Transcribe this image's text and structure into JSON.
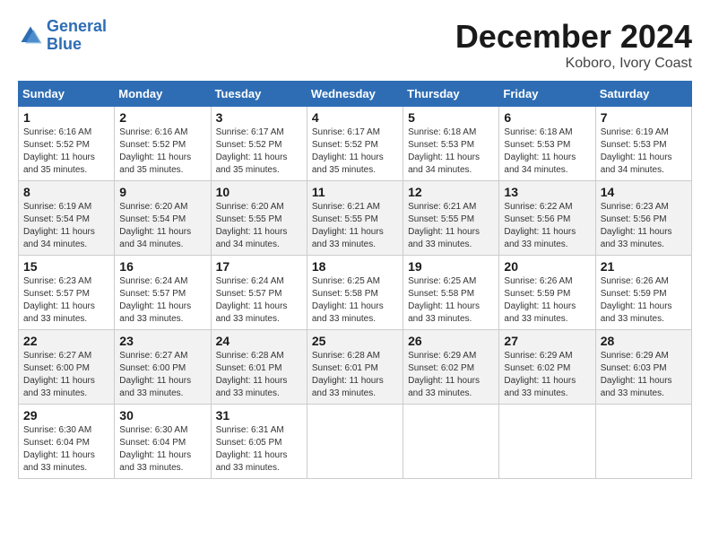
{
  "logo": {
    "line1": "General",
    "line2": "Blue"
  },
  "title": "December 2024",
  "subtitle": "Koboro, Ivory Coast",
  "days_header": [
    "Sunday",
    "Monday",
    "Tuesday",
    "Wednesday",
    "Thursday",
    "Friday",
    "Saturday"
  ],
  "weeks": [
    [
      {
        "day": "1",
        "sunrise": "6:16 AM",
        "sunset": "5:52 PM",
        "daylight": "11 hours and 35 minutes."
      },
      {
        "day": "2",
        "sunrise": "6:16 AM",
        "sunset": "5:52 PM",
        "daylight": "11 hours and 35 minutes."
      },
      {
        "day": "3",
        "sunrise": "6:17 AM",
        "sunset": "5:52 PM",
        "daylight": "11 hours and 35 minutes."
      },
      {
        "day": "4",
        "sunrise": "6:17 AM",
        "sunset": "5:52 PM",
        "daylight": "11 hours and 35 minutes."
      },
      {
        "day": "5",
        "sunrise": "6:18 AM",
        "sunset": "5:53 PM",
        "daylight": "11 hours and 34 minutes."
      },
      {
        "day": "6",
        "sunrise": "6:18 AM",
        "sunset": "5:53 PM",
        "daylight": "11 hours and 34 minutes."
      },
      {
        "day": "7",
        "sunrise": "6:19 AM",
        "sunset": "5:53 PM",
        "daylight": "11 hours and 34 minutes."
      }
    ],
    [
      {
        "day": "8",
        "sunrise": "6:19 AM",
        "sunset": "5:54 PM",
        "daylight": "11 hours and 34 minutes."
      },
      {
        "day": "9",
        "sunrise": "6:20 AM",
        "sunset": "5:54 PM",
        "daylight": "11 hours and 34 minutes."
      },
      {
        "day": "10",
        "sunrise": "6:20 AM",
        "sunset": "5:55 PM",
        "daylight": "11 hours and 34 minutes."
      },
      {
        "day": "11",
        "sunrise": "6:21 AM",
        "sunset": "5:55 PM",
        "daylight": "11 hours and 33 minutes."
      },
      {
        "day": "12",
        "sunrise": "6:21 AM",
        "sunset": "5:55 PM",
        "daylight": "11 hours and 33 minutes."
      },
      {
        "day": "13",
        "sunrise": "6:22 AM",
        "sunset": "5:56 PM",
        "daylight": "11 hours and 33 minutes."
      },
      {
        "day": "14",
        "sunrise": "6:23 AM",
        "sunset": "5:56 PM",
        "daylight": "11 hours and 33 minutes."
      }
    ],
    [
      {
        "day": "15",
        "sunrise": "6:23 AM",
        "sunset": "5:57 PM",
        "daylight": "11 hours and 33 minutes."
      },
      {
        "day": "16",
        "sunrise": "6:24 AM",
        "sunset": "5:57 PM",
        "daylight": "11 hours and 33 minutes."
      },
      {
        "day": "17",
        "sunrise": "6:24 AM",
        "sunset": "5:57 PM",
        "daylight": "11 hours and 33 minutes."
      },
      {
        "day": "18",
        "sunrise": "6:25 AM",
        "sunset": "5:58 PM",
        "daylight": "11 hours and 33 minutes."
      },
      {
        "day": "19",
        "sunrise": "6:25 AM",
        "sunset": "5:58 PM",
        "daylight": "11 hours and 33 minutes."
      },
      {
        "day": "20",
        "sunrise": "6:26 AM",
        "sunset": "5:59 PM",
        "daylight": "11 hours and 33 minutes."
      },
      {
        "day": "21",
        "sunrise": "6:26 AM",
        "sunset": "5:59 PM",
        "daylight": "11 hours and 33 minutes."
      }
    ],
    [
      {
        "day": "22",
        "sunrise": "6:27 AM",
        "sunset": "6:00 PM",
        "daylight": "11 hours and 33 minutes."
      },
      {
        "day": "23",
        "sunrise": "6:27 AM",
        "sunset": "6:00 PM",
        "daylight": "11 hours and 33 minutes."
      },
      {
        "day": "24",
        "sunrise": "6:28 AM",
        "sunset": "6:01 PM",
        "daylight": "11 hours and 33 minutes."
      },
      {
        "day": "25",
        "sunrise": "6:28 AM",
        "sunset": "6:01 PM",
        "daylight": "11 hours and 33 minutes."
      },
      {
        "day": "26",
        "sunrise": "6:29 AM",
        "sunset": "6:02 PM",
        "daylight": "11 hours and 33 minutes."
      },
      {
        "day": "27",
        "sunrise": "6:29 AM",
        "sunset": "6:02 PM",
        "daylight": "11 hours and 33 minutes."
      },
      {
        "day": "28",
        "sunrise": "6:29 AM",
        "sunset": "6:03 PM",
        "daylight": "11 hours and 33 minutes."
      }
    ],
    [
      {
        "day": "29",
        "sunrise": "6:30 AM",
        "sunset": "6:04 PM",
        "daylight": "11 hours and 33 minutes."
      },
      {
        "day": "30",
        "sunrise": "6:30 AM",
        "sunset": "6:04 PM",
        "daylight": "11 hours and 33 minutes."
      },
      {
        "day": "31",
        "sunrise": "6:31 AM",
        "sunset": "6:05 PM",
        "daylight": "11 hours and 33 minutes."
      },
      null,
      null,
      null,
      null
    ]
  ]
}
